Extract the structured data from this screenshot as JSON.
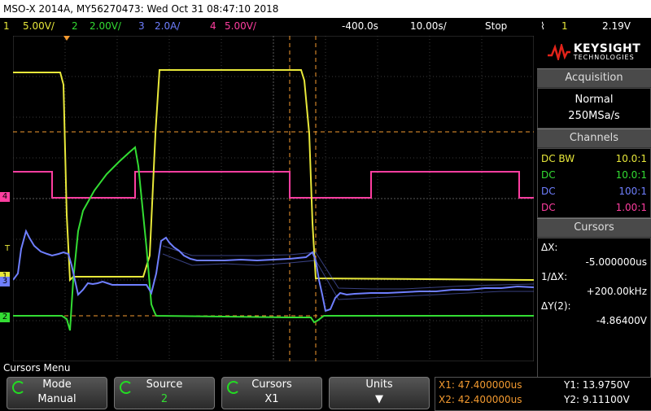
{
  "title": "MSO-X 2014A, MY56270473: Wed Oct 31 08:47:10 2018",
  "status": {
    "ch1": {
      "num": "1",
      "scale": "5.00V/",
      "color": "#e8e83a"
    },
    "ch2": {
      "num": "2",
      "scale": "2.00V/",
      "color": "#33dd33"
    },
    "ch3": {
      "num": "3",
      "scale": "2.0A/",
      "color": "#6f7fff"
    },
    "ch4": {
      "num": "4",
      "scale": "5.00V/",
      "color": "#ff3ea0"
    },
    "delay": "-400.0s",
    "timebase": "10.00s/",
    "run_state": "Stop",
    "trigger_icon": "trigger-rising-edge-icon",
    "trigger_ch": "1",
    "trigger_level": "2.19V"
  },
  "panel": {
    "brand": "KEYSIGHT",
    "brand_sub": "TECHNOLOGIES",
    "acquisition_title": "Acquisition",
    "acq_mode": "Normal",
    "acq_rate": "250MSa/s",
    "channels_title": "Channels",
    "channels": [
      {
        "coupling": "DC BW",
        "probe": "10.0:1",
        "color": "#e8e83a"
      },
      {
        "coupling": "DC",
        "probe": "10.0:1",
        "color": "#33dd33"
      },
      {
        "coupling": "DC",
        "probe": "100:1",
        "color": "#6f7fff"
      },
      {
        "coupling": "DC",
        "probe": "1.00:1",
        "color": "#ff3ea0"
      }
    ],
    "cursors_title": "Cursors",
    "dx_label": "ΔX:",
    "dx_value": "-5.000000us",
    "inv_dx_label": "1/ΔX:",
    "inv_dx_value": "+200.00kHz",
    "dy_label": "ΔY(2):",
    "dy_value": "-4.86400V"
  },
  "menu": {
    "title": "Cursors Menu",
    "mode_label": "Mode",
    "mode_value": "Manual",
    "source_label": "Source",
    "source_value": "2",
    "cursors_label": "Cursors",
    "cursors_value": "X1",
    "units_label": "Units",
    "x1": "X1: 47.400000us",
    "x2": "X2: 42.400000us",
    "y1": "Y1: 13.9750V",
    "y2": "Y2: 9.11100V"
  },
  "markers": {
    "t": "T",
    "ch1": "1",
    "ch2": "2",
    "ch3": "3",
    "ch4": "4"
  }
}
